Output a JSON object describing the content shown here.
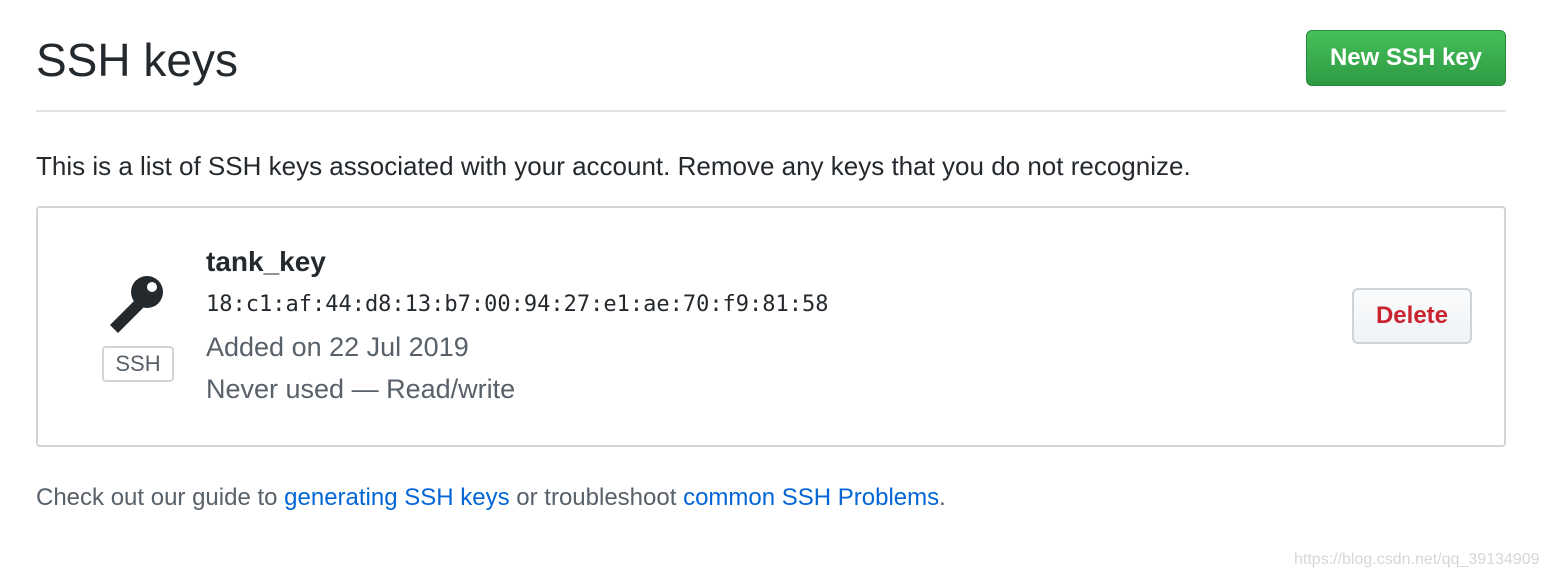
{
  "header": {
    "title": "SSH keys",
    "new_key_button": "New SSH key"
  },
  "intro_text": "This is a list of SSH keys associated with your account. Remove any keys that you do not recognize.",
  "keys": [
    {
      "icon": "key-icon",
      "type_label": "SSH",
      "title": "tank_key",
      "fingerprint": "18:c1:af:44:d8:13:b7:00:94:27:e1:ae:70:f9:81:58",
      "added": "Added on 22 Jul 2019",
      "usage": "Never used — Read/write",
      "delete_label": "Delete"
    }
  ],
  "footer": {
    "prefix": "Check out our guide to ",
    "link1": "generating SSH keys",
    "middle": " or troubleshoot ",
    "link2": "common SSH Problems",
    "suffix": "."
  },
  "watermark": "https://blog.csdn.net/qq_39134909",
  "colors": {
    "primary_button": "#2ea44f",
    "danger_text": "#cb2431",
    "link": "#0366d6"
  }
}
